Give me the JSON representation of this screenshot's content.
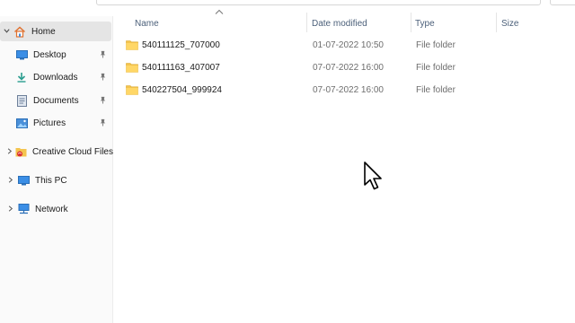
{
  "nav": {
    "items": [
      {
        "label": "Home",
        "icon": "home-icon",
        "selected": true,
        "expanded": true
      },
      {
        "label": "Desktop",
        "icon": "desktop-icon",
        "pinned": true
      },
      {
        "label": "Downloads",
        "icon": "download-icon",
        "pinned": true
      },
      {
        "label": "Documents",
        "icon": "documents-icon",
        "pinned": true
      },
      {
        "label": "Pictures",
        "icon": "pictures-icon",
        "pinned": true
      },
      {
        "label": "Creative Cloud Files",
        "icon": "creative-cloud-icon"
      },
      {
        "label": "This PC",
        "icon": "computer-icon"
      },
      {
        "label": "Network",
        "icon": "network-icon"
      }
    ]
  },
  "columns": {
    "name": "Name",
    "date": "Date modified",
    "type": "Type",
    "size": "Size"
  },
  "rows": [
    {
      "name": "540111125_707000",
      "date": "01-07-2022 10:50",
      "type": "File folder"
    },
    {
      "name": "540111163_407007",
      "date": "07-07-2022 16:00",
      "type": "File folder"
    },
    {
      "name": "540227504_999924",
      "date": "07-07-2022 16:00",
      "type": "File folder"
    }
  ],
  "colors": {
    "folder": "#f4c44e",
    "selected_bg": "#e5e5e5",
    "header_text": "#4c607a"
  }
}
